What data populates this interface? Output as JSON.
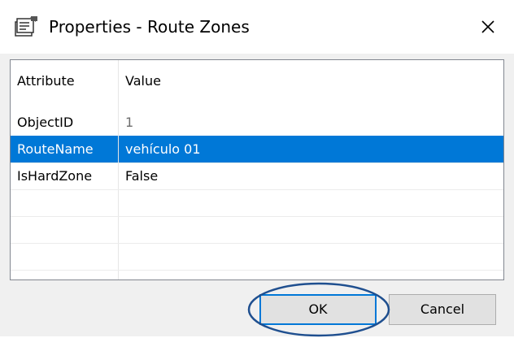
{
  "window": {
    "title": "Properties - Route Zones",
    "title_icon": "properties-icon",
    "close_icon": "close-icon"
  },
  "grid": {
    "columns": [
      "Attribute",
      "Value"
    ],
    "rows": [
      {
        "attribute": "ObjectID",
        "value": "1",
        "selected": false,
        "readonly": true
      },
      {
        "attribute": "RouteName",
        "value": "vehículo 01",
        "selected": true,
        "readonly": false
      },
      {
        "attribute": "IsHardZone",
        "value": "False",
        "selected": false,
        "readonly": false
      }
    ],
    "selection_color": "#0078d7"
  },
  "buttons": {
    "ok_label": "OK",
    "cancel_label": "Cancel"
  },
  "annotation": {
    "highlight_color": "#1f4f8f",
    "highlighted_control": "ok-button"
  }
}
